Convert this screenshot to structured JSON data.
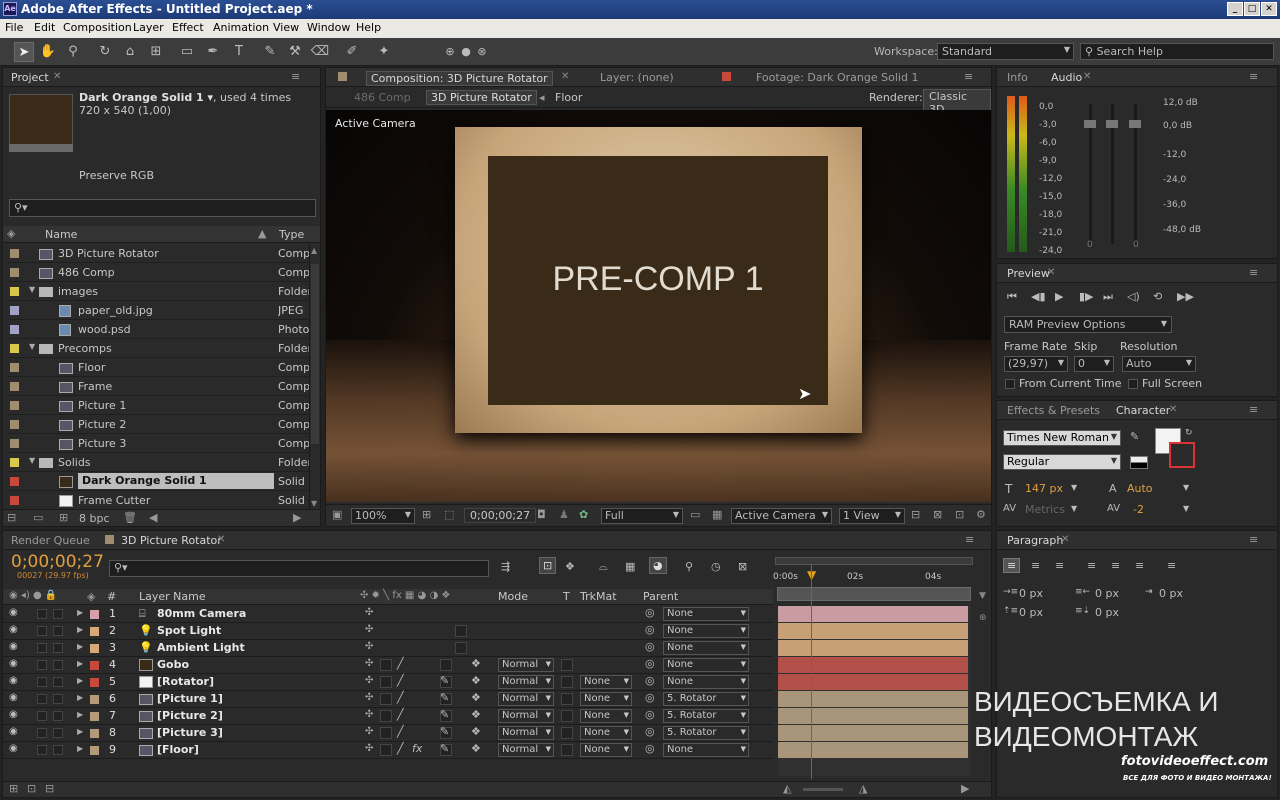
{
  "title_bar": {
    "app_icon": "Ae",
    "title": "Adobe After Effects - Untitled Project.aep *",
    "min": "_",
    "max": "□",
    "close": "✕"
  },
  "menu": [
    "File",
    "Edit",
    "Composition",
    "Layer",
    "Effect",
    "Animation",
    "View",
    "Window",
    "Help"
  ],
  "toolbar": {
    "workspace_label": "Workspace:",
    "workspace_value": "Standard",
    "search_placeholder": "Search Help"
  },
  "project": {
    "tab": "Project",
    "item_name": "Dark Orange Solid 1 ▾",
    "item_used": ", used 4 times",
    "item_size": "720 x 540 (1,00)",
    "preserve": "Preserve RGB",
    "col_name": "Name",
    "col_type": "Type",
    "bpc": "8 bpc",
    "rows": [
      {
        "name": "3D Picture Rotator",
        "type": "Comp",
        "color": "#a08c6e",
        "icon": "comp",
        "indent": 0
      },
      {
        "name": "486 Comp",
        "type": "Comp",
        "color": "#a08c6e",
        "icon": "comp",
        "indent": 0
      },
      {
        "name": "images",
        "type": "Folder",
        "color": "#d9c84a",
        "icon": "folder",
        "indent": 0
      },
      {
        "name": "paper_old.jpg",
        "type": "JPEG",
        "color": "#a2a2c8",
        "icon": "image",
        "indent": 1
      },
      {
        "name": "wood.psd",
        "type": "Photo",
        "color": "#a2a2c8",
        "icon": "image",
        "indent": 1
      },
      {
        "name": "Precomps",
        "type": "Folder",
        "color": "#d9c84a",
        "icon": "folder",
        "indent": 0
      },
      {
        "name": "Floor",
        "type": "Comp",
        "color": "#a08c6e",
        "icon": "comp",
        "indent": 1
      },
      {
        "name": "Frame",
        "type": "Comp",
        "color": "#a08c6e",
        "icon": "comp",
        "indent": 1
      },
      {
        "name": "Picture 1",
        "type": "Comp",
        "color": "#a08c6e",
        "icon": "comp",
        "indent": 1
      },
      {
        "name": "Picture 2",
        "type": "Comp",
        "color": "#a08c6e",
        "icon": "comp",
        "indent": 1
      },
      {
        "name": "Picture 3",
        "type": "Comp",
        "color": "#a08c6e",
        "icon": "comp",
        "indent": 1
      },
      {
        "name": "Solids",
        "type": "Folder",
        "color": "#d9c84a",
        "icon": "folder",
        "indent": 0
      },
      {
        "name": "Dark Orange Solid 1",
        "type": "Solid",
        "color": "#c8483c",
        "icon": "solid-dark",
        "indent": 1,
        "selected": true
      },
      {
        "name": "Frame Cutter",
        "type": "Solid",
        "color": "#c8483c",
        "icon": "solid-white",
        "indent": 1
      }
    ]
  },
  "comp": {
    "tab_comp": "Composition: 3D Picture Rotator",
    "tab_layer": "Layer: (none)",
    "tab_footage": "Footage: Dark Orange Solid 1",
    "crumb_486": "486 Comp",
    "crumb_active": "3D Picture Rotator",
    "crumb_floor": "Floor",
    "renderer_label": "Renderer:",
    "renderer_value": "Classic 3D",
    "view_label": "Active Camera",
    "frame_text": "PRE-COMP 1",
    "zoom": "100%",
    "timecode": "0;00;00;27",
    "quality": "Full",
    "camera": "Active Camera",
    "views": "1 View"
  },
  "info_audio": {
    "tab_info": "Info",
    "tab_audio": "Audio",
    "left_scale": [
      "0,0",
      "-3,0",
      "-6,0",
      "-9,0",
      "-12,0",
      "-15,0",
      "-18,0",
      "-21,0",
      "-24,0"
    ],
    "right_scale": [
      "12,0 dB",
      "0,0 dB",
      "-12,0",
      "-24,0",
      "-36,0",
      "-48,0 dB"
    ],
    "zero_a": "0",
    "zero_b": "0"
  },
  "preview": {
    "tab": "Preview",
    "ram_options": "RAM Preview Options",
    "frame_rate_label": "Frame Rate",
    "skip_label": "Skip",
    "resolution_label": "Resolution",
    "frame_rate": "(29,97)",
    "skip": "0",
    "resolution": "Auto",
    "from_current": "From Current Time",
    "full_screen": "Full Screen"
  },
  "character": {
    "tab_effects": "Effects & Presets",
    "tab_char": "Character",
    "font": "Times New Roman",
    "style": "Regular",
    "size": "147 px",
    "leading": "Auto",
    "kerning": "Metrics",
    "tracking": "-2"
  },
  "paragraph": {
    "tab": "Paragraph",
    "v1": "0 px",
    "v2": "0 px",
    "v3": "0 px",
    "v4": "0 px",
    "v5": "0 px"
  },
  "timeline": {
    "tab_render": "Render Queue",
    "tab_comp": "3D Picture Rotator",
    "timecode": "0;00;00;27",
    "frames": "00027 (29.97 fps)",
    "search_placeholder": "",
    "col_num": "#",
    "col_layer": "Layer Name",
    "col_mode": "Mode",
    "col_t": "T",
    "col_trkmat": "TrkMat",
    "col_parent": "Parent",
    "ruler": [
      "0:00s",
      "02s",
      "04s"
    ],
    "layers": [
      {
        "num": "1",
        "name": "80mm Camera",
        "icon": "camera",
        "color": "#d7a0a8",
        "bar": "#c89ca0",
        "mode": "",
        "trkmat": "",
        "parent": "None",
        "fx": false
      },
      {
        "num": "2",
        "name": "Spot Light",
        "icon": "light",
        "color": "#d8a878",
        "bar": "#c8a078",
        "mode": "",
        "trkmat": "",
        "parent": "None",
        "fx": false
      },
      {
        "num": "3",
        "name": "Ambient Light",
        "icon": "light",
        "color": "#d8a878",
        "bar": "#c8a078",
        "mode": "",
        "trkmat": "",
        "parent": "None",
        "fx": false
      },
      {
        "num": "4",
        "name": "Gobo",
        "icon": "solid-dark",
        "color": "#c8483c",
        "bar": "#b4504a",
        "mode": "Normal",
        "trkmat": "",
        "parent": "None",
        "fx": false
      },
      {
        "num": "5",
        "name": "[Rotator]",
        "icon": "solid-white",
        "color": "#c8483c",
        "bar": "#b4504a",
        "mode": "Normal",
        "trkmat": "None",
        "parent": "None",
        "fx": false
      },
      {
        "num": "6",
        "name": "[Picture 1]",
        "icon": "comp",
        "color": "#b49a78",
        "bar": "#a8957a",
        "mode": "Normal",
        "trkmat": "None",
        "parent": "5. Rotator",
        "fx": false
      },
      {
        "num": "7",
        "name": "[Picture 2]",
        "icon": "comp",
        "color": "#b49a78",
        "bar": "#a8957a",
        "mode": "Normal",
        "trkmat": "None",
        "parent": "5. Rotator",
        "fx": false
      },
      {
        "num": "8",
        "name": "[Picture 3]",
        "icon": "comp",
        "color": "#b49a78",
        "bar": "#a8957a",
        "mode": "Normal",
        "trkmat": "None",
        "parent": "5. Rotator",
        "fx": false
      },
      {
        "num": "9",
        "name": "[Floor]",
        "icon": "comp",
        "color": "#b49a78",
        "bar": "#a8957a",
        "mode": "Normal",
        "trkmat": "None",
        "parent": "None",
        "fx": true
      }
    ]
  },
  "watermark": {
    "line1": "ВИДЕОСЪЕМКА И",
    "line2": "ВИДЕОМОНТАЖ",
    "site": "fotovideoeffect.com",
    "tagline": "ВСЕ ДЛЯ ФОТО И ВИДЕО МОНТАЖА!"
  }
}
